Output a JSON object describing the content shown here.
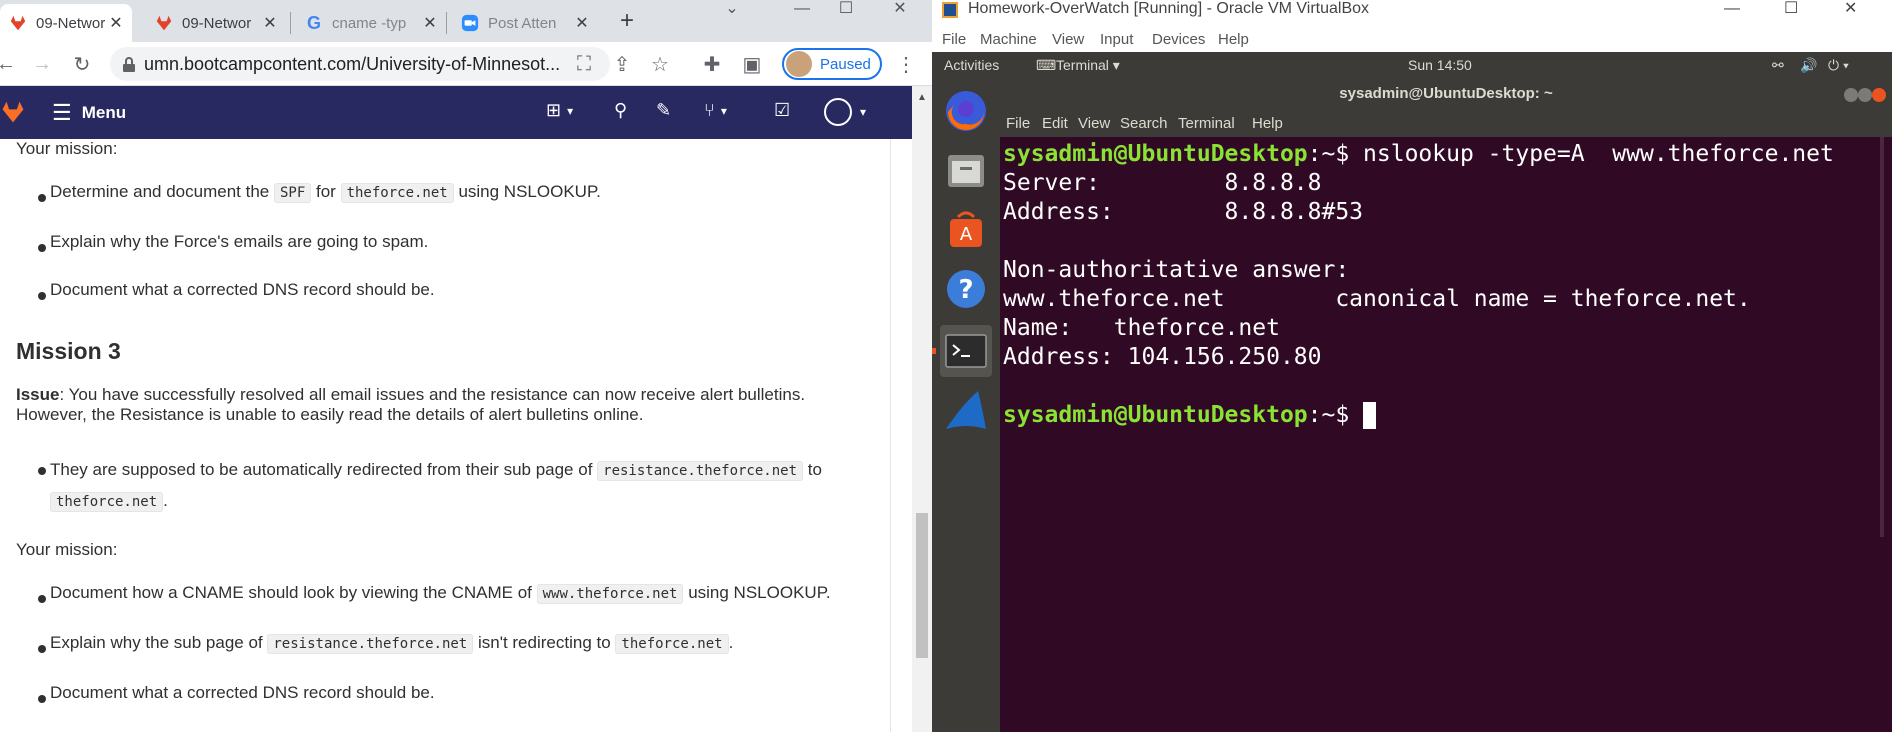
{
  "browser": {
    "tabs": [
      {
        "label": "09-Networ",
        "active": true,
        "icon": "gitlab-icon"
      },
      {
        "label": "09-Networ",
        "active": false,
        "icon": "gitlab-icon"
      },
      {
        "label": "cname -typ",
        "active": false,
        "icon": "google-icon"
      },
      {
        "label": "Post Atten",
        "active": false,
        "icon": "zoom-icon"
      }
    ],
    "url": "umn.bootcampcontent.com/University-of-Minnesot...",
    "profile_label": "Paused",
    "accent": "#1a73e8"
  },
  "gitlab": {
    "menu_label": "Menu",
    "nav_color": "#292961"
  },
  "content": {
    "mission_intro_1": "Your mission:",
    "m2_items": [
      {
        "pre": "Determine and document the ",
        "code1": "SPF",
        "mid": " for ",
        "code2": "theforce.net",
        "post": " using NSLOOKUP."
      },
      {
        "text": "Explain why the Force's emails are going to spam."
      },
      {
        "text": "Document what a corrected DNS record should be."
      }
    ],
    "mission3_heading": "Mission 3",
    "issue_label": "Issue",
    "issue_text": ": You have successfully resolved all email issues and the resistance can now receive alert bulletins.",
    "issue_text2": "However, the Resistance is unable to easily read the details of alert bulletins online.",
    "m3_bullet": {
      "pre": "They are supposed to be automatically redirected from their sub page of ",
      "code1": "resistance.theforce.net",
      "mid": " to",
      "code2": "theforce.net",
      "post": "."
    },
    "mission_intro_2": "Your mission:",
    "m3_items": [
      {
        "pre": "Document how a CNAME should look by viewing the CNAME of ",
        "code1": "www.theforce.net",
        "post": " using NSLOOKUP."
      },
      {
        "pre": "Explain why the sub page of ",
        "code1": "resistance.theforce.net",
        "mid": " isn't redirecting to ",
        "code2": "theforce.net",
        "post": "."
      },
      {
        "text": "Document what a corrected DNS record should be."
      }
    ]
  },
  "vbox": {
    "title": "Homework-OverWatch [Running] - Oracle VM VirtualBox",
    "menu": [
      "File",
      "Machine",
      "View",
      "Input",
      "Devices",
      "Help"
    ],
    "ubuntu": {
      "activities": "Activities",
      "app_label": "Terminal ▾",
      "clock": "Sun 14:50"
    },
    "terminal": {
      "title": "sysadmin@UbuntuDesktop: ~",
      "menu": [
        "File",
        "Edit",
        "View",
        "Search",
        "Terminal",
        "Help"
      ],
      "prompt": "sysadmin@UbuntuDesktop",
      "cmd": ":~$ nslookup -type=A  www.theforce.net",
      "lines": [
        "Server:         8.8.8.8",
        "Address:        8.8.8.8#53",
        "",
        "Non-authoritative answer:",
        "www.theforce.net        canonical name = theforce.net.",
        "Name:   theforce.net",
        "Address: 104.156.250.80",
        ""
      ],
      "prompt2_suffix": ":~$ "
    }
  }
}
